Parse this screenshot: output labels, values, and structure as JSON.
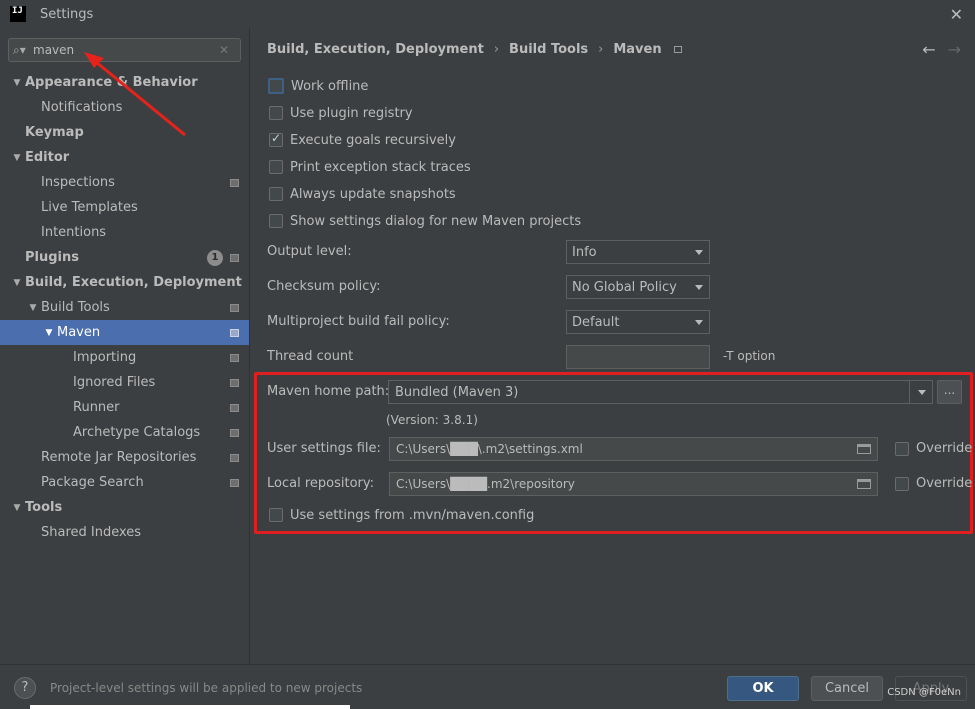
{
  "window": {
    "title": "Settings",
    "logo_text": "IJ"
  },
  "search": {
    "value": "maven",
    "placeholder": ""
  },
  "tree": [
    {
      "label": "Appearance & Behavior",
      "level": 0,
      "expandable": true,
      "bold": true
    },
    {
      "label": "Notifications",
      "level": 1
    },
    {
      "label": "Keymap",
      "level": 0,
      "bold": true
    },
    {
      "label": "Editor",
      "level": 0,
      "expandable": true,
      "bold": true
    },
    {
      "label": "Inspections",
      "level": 1,
      "icon": true
    },
    {
      "label": "Live Templates",
      "level": 1
    },
    {
      "label": "Intentions",
      "level": 1
    },
    {
      "label": "Plugins",
      "level": 0,
      "bold": true,
      "badge": "1",
      "icon": true
    },
    {
      "label": "Build, Execution, Deployment",
      "level": 0,
      "expandable": true,
      "bold": true
    },
    {
      "label": "Build Tools",
      "level": 1,
      "expandable": true,
      "icon": true
    },
    {
      "label": "Maven",
      "level": 2,
      "expandable": true,
      "icon": true,
      "selected": true
    },
    {
      "label": "Importing",
      "level": 3,
      "icon": true
    },
    {
      "label": "Ignored Files",
      "level": 3,
      "icon": true
    },
    {
      "label": "Runner",
      "level": 3,
      "icon": true
    },
    {
      "label": "Archetype Catalogs",
      "level": 3,
      "icon": true
    },
    {
      "label": "Remote Jar Repositories",
      "level": 1,
      "icon": true
    },
    {
      "label": "Package Search",
      "level": 1,
      "icon": true
    },
    {
      "label": "Tools",
      "level": 0,
      "expandable": true,
      "bold": true
    },
    {
      "label": "Shared Indexes",
      "level": 1
    }
  ],
  "breadcrumb": [
    "Build, Execution, Deployment",
    "Build Tools",
    "Maven"
  ],
  "checkboxes": [
    {
      "label": "Work offline",
      "checked": false,
      "focused": true
    },
    {
      "label": "Use plugin registry",
      "checked": false
    },
    {
      "label": "Execute goals recursively",
      "checked": true
    },
    {
      "label": "Print exception stack traces",
      "checked": false
    },
    {
      "label": "Always update snapshots",
      "checked": false
    },
    {
      "label": "Show settings dialog for new Maven projects",
      "checked": false
    }
  ],
  "form": {
    "output_level": {
      "label": "Output level:",
      "value": "Info"
    },
    "checksum_policy": {
      "label": "Checksum policy:",
      "value": "No Global Policy"
    },
    "multiproject_policy": {
      "label": "Multiproject build fail policy:",
      "value": "Default"
    },
    "thread_count": {
      "label": "Thread count",
      "value": "",
      "suffix": "-T option"
    },
    "maven_home": {
      "label": "Maven home path:",
      "value": "Bundled (Maven 3)",
      "browse_label": "...",
      "version": "(Version: 3.8.1)"
    },
    "user_settings": {
      "label": "User settings file:",
      "value": "C:\\Users\\███\\.m2\\settings.xml",
      "override_label": "Override"
    },
    "local_repo": {
      "label": "Local repository:",
      "value": "C:\\Users\\████.m2\\repository",
      "override_label": "Override"
    },
    "use_mvn_config": {
      "label": "Use settings from .mvn/maven.config",
      "checked": false
    }
  },
  "footer": {
    "help_label": "?",
    "note": "Project-level settings will be applied to new projects",
    "ok": "OK",
    "cancel": "Cancel",
    "apply": "Apply",
    "watermark": "CSDN @F0eNn"
  },
  "colors": {
    "accent": "#4b6eaf",
    "highlight_box": "#e02020",
    "ok_button": "#365880"
  }
}
